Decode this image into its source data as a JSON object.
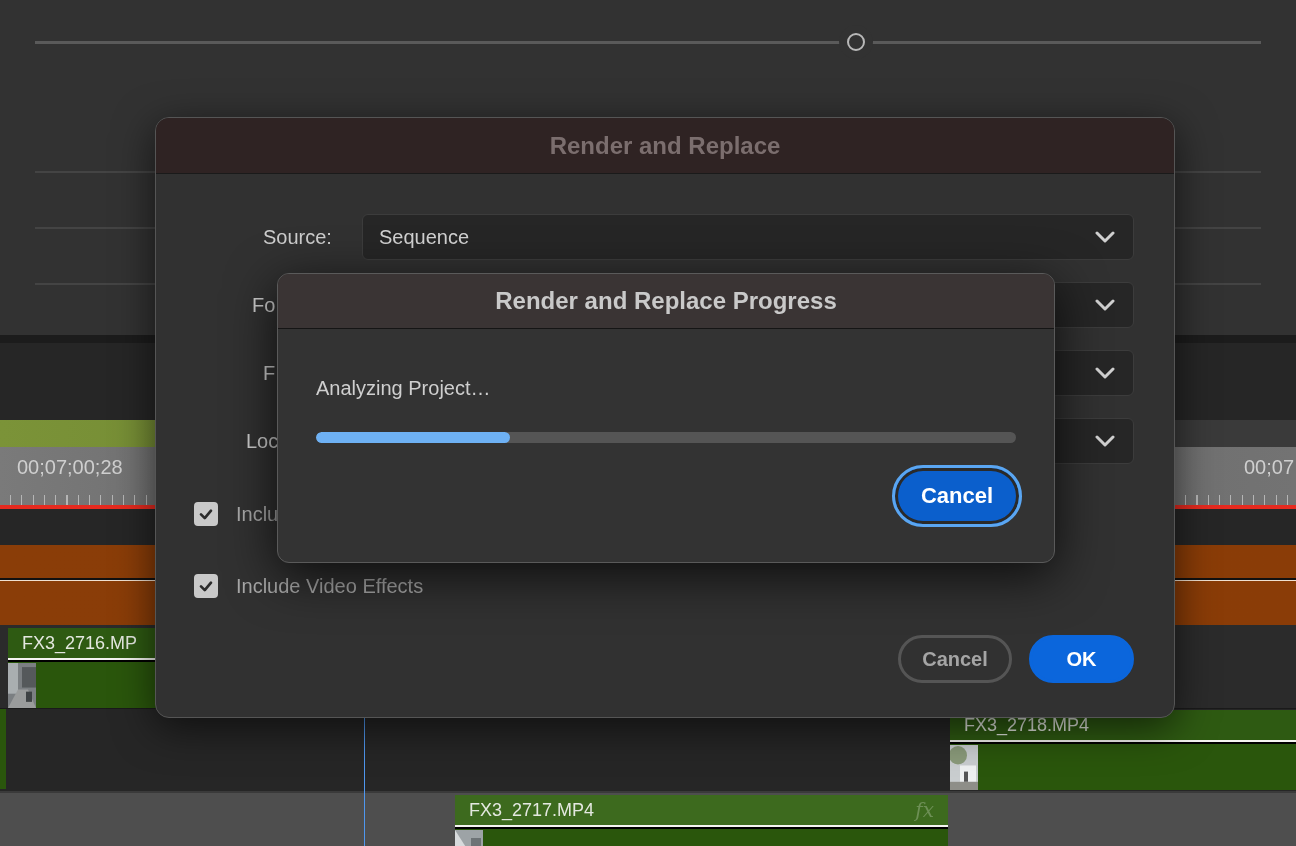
{
  "monitor": {
    "scrubber": {
      "level": 0.67
    }
  },
  "timeline": {
    "timecodes": [
      "00;07;00;28",
      "00;07"
    ],
    "clips": [
      {
        "name": "FX3_2716.MP"
      },
      {
        "name": "FX3_2718.MP4"
      },
      {
        "name": "FX3_2717.MP4",
        "badge": "fx"
      }
    ]
  },
  "dialog": {
    "title": "Render and Replace",
    "fields": [
      {
        "label": "Source:",
        "value": "Sequence"
      },
      {
        "label": "Fo"
      },
      {
        "label": "F"
      },
      {
        "label": "Loc"
      }
    ],
    "checkboxes": [
      {
        "label": "Inclu",
        "checked": true
      },
      {
        "label": "Include Video Effects",
        "checked": true
      }
    ],
    "buttons": [
      {
        "label": "Cancel",
        "kind": "secondary"
      },
      {
        "label": "OK",
        "kind": "primary"
      }
    ]
  },
  "progress_dialog": {
    "title": "Render and Replace Progress",
    "status": "Analyzing Project…",
    "level": 0.277,
    "buttons": [
      {
        "label": "Cancel",
        "focused": true
      }
    ]
  }
}
